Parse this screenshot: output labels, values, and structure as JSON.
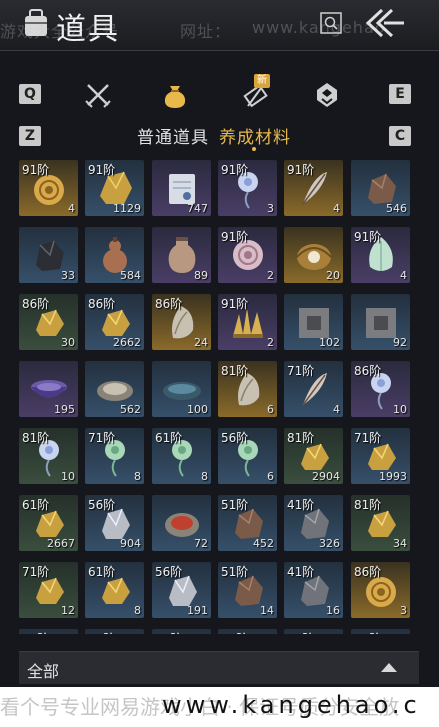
{
  "header": {
    "title": "道具",
    "watermark_parts": [
      "游戏大全公众号",
      "网址：",
      "www.kangehao"
    ],
    "icons": [
      "bag-icon",
      "search-icon",
      "back-icon"
    ]
  },
  "categories": [
    {
      "key": "Q"
    },
    {
      "name": "weapons",
      "icon": "crossed-swords-icon"
    },
    {
      "name": "materials",
      "icon": "pouch-icon",
      "active": true
    },
    {
      "name": "scrolls",
      "icon": "scroll-icon",
      "badge": "新"
    },
    {
      "name": "gems",
      "icon": "gem-icon"
    },
    {
      "key": "E"
    }
  ],
  "tabs": {
    "left_key": "Z",
    "right_key": "C",
    "normal": "普通道具",
    "active": "养成材料"
  },
  "items": [
    {
      "tier": "91阶",
      "count": "4",
      "kind": "snail",
      "rarity": "gold"
    },
    {
      "tier": "91阶",
      "count": "1129",
      "kind": "ore",
      "rarity": "blue"
    },
    {
      "tier": "",
      "count": "747",
      "kind": "scroll",
      "rarity": "purple"
    },
    {
      "tier": "91阶",
      "count": "3",
      "kind": "flower",
      "rarity": "purple"
    },
    {
      "tier": "91阶",
      "count": "4",
      "kind": "feather",
      "rarity": "gold"
    },
    {
      "tier": "",
      "count": "546",
      "kind": "rock",
      "rarity": "blue"
    },
    {
      "tier": "",
      "count": "33",
      "kind": "dark-rock",
      "rarity": "blue"
    },
    {
      "tier": "",
      "count": "584",
      "kind": "gourd",
      "rarity": "blue"
    },
    {
      "tier": "",
      "count": "89",
      "kind": "bottle",
      "rarity": "purple"
    },
    {
      "tier": "91阶",
      "count": "2",
      "kind": "shell",
      "rarity": "purple"
    },
    {
      "tier": "",
      "count": "20",
      "kind": "pearl",
      "rarity": "gold"
    },
    {
      "tier": "91阶",
      "count": "4",
      "kind": "jade-bud",
      "rarity": "purple"
    },
    {
      "tier": "86阶",
      "count": "30",
      "kind": "gold-ore",
      "rarity": "green"
    },
    {
      "tier": "86阶",
      "count": "2662",
      "kind": "gold-ore",
      "rarity": "blue"
    },
    {
      "tier": "86阶",
      "count": "24",
      "kind": "scale",
      "rarity": "gold"
    },
    {
      "tier": "91阶",
      "count": "2",
      "kind": "crystal",
      "rarity": "purple"
    },
    {
      "tier": "",
      "count": "102",
      "kind": "stone-block",
      "rarity": "blue"
    },
    {
      "tier": "",
      "count": "92",
      "kind": "stone-block",
      "rarity": "blue"
    },
    {
      "tier": "",
      "count": "195",
      "kind": "bowl",
      "rarity": "purple"
    },
    {
      "tier": "",
      "count": "562",
      "kind": "dish",
      "rarity": "blue"
    },
    {
      "tier": "",
      "count": "100",
      "kind": "tray",
      "rarity": "blue"
    },
    {
      "tier": "81阶",
      "count": "6",
      "kind": "scale",
      "rarity": "gold"
    },
    {
      "tier": "71阶",
      "count": "4",
      "kind": "feather",
      "rarity": "blue"
    },
    {
      "tier": "86阶",
      "count": "10",
      "kind": "flower",
      "rarity": "purple"
    },
    {
      "tier": "81阶",
      "count": "10",
      "kind": "flower",
      "rarity": "green"
    },
    {
      "tier": "71阶",
      "count": "8",
      "kind": "flower-green",
      "rarity": "blue"
    },
    {
      "tier": "61阶",
      "count": "8",
      "kind": "flower-green",
      "rarity": "blue"
    },
    {
      "tier": "56阶",
      "count": "6",
      "kind": "flower-green",
      "rarity": "blue"
    },
    {
      "tier": "81阶",
      "count": "2904",
      "kind": "gold-ore",
      "rarity": "green"
    },
    {
      "tier": "71阶",
      "count": "1993",
      "kind": "gold-ore",
      "rarity": "blue"
    },
    {
      "tier": "61阶",
      "count": "2667",
      "kind": "gold-ore",
      "rarity": "green"
    },
    {
      "tier": "56阶",
      "count": "904",
      "kind": "silver-ore",
      "rarity": "blue"
    },
    {
      "tier": "",
      "count": "72",
      "kind": "cinnabar",
      "rarity": "blue"
    },
    {
      "tier": "51阶",
      "count": "452",
      "kind": "rock",
      "rarity": "blue"
    },
    {
      "tier": "41阶",
      "count": "326",
      "kind": "grey-rock",
      "rarity": "blue"
    },
    {
      "tier": "81阶",
      "count": "34",
      "kind": "gold-ore",
      "rarity": "green"
    },
    {
      "tier": "71阶",
      "count": "12",
      "kind": "gold-ore",
      "rarity": "green"
    },
    {
      "tier": "61阶",
      "count": "8",
      "kind": "gold-ore",
      "rarity": "blue"
    },
    {
      "tier": "56阶",
      "count": "191",
      "kind": "silver-ore",
      "rarity": "blue"
    },
    {
      "tier": "51阶",
      "count": "14",
      "kind": "rock",
      "rarity": "blue"
    },
    {
      "tier": "41阶",
      "count": "16",
      "kind": "grey-rock",
      "rarity": "blue"
    },
    {
      "tier": "86阶",
      "count": "3",
      "kind": "snail",
      "rarity": "gold"
    },
    {
      "tier": "81阶",
      "count": "",
      "kind": "",
      "rarity": "blue"
    },
    {
      "tier": "71阶",
      "count": "",
      "kind": "",
      "rarity": "blue"
    },
    {
      "tier": "61阶",
      "count": "",
      "kind": "",
      "rarity": "blue"
    },
    {
      "tier": "86阶",
      "count": "",
      "kind": "",
      "rarity": "blue"
    },
    {
      "tier": "81阶",
      "count": "",
      "kind": "",
      "rarity": "blue"
    },
    {
      "tier": "71阶",
      "count": "",
      "kind": "",
      "rarity": "blue"
    }
  ],
  "filter": {
    "label": "全部",
    "arrow": "up-arrow-icon"
  },
  "footer_watermark": {
    "cn": "看个号专业网易游戏小白 · 保证号质分安全放",
    "url": "www.kangehao.c"
  }
}
